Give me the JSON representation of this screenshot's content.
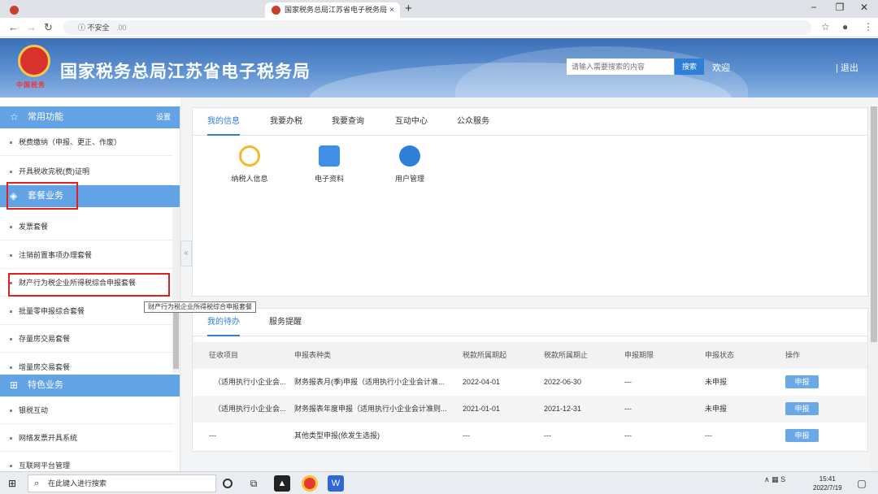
{
  "browser": {
    "tab_active_title": "国家税务总局江苏省电子税务局",
    "tab_close": "×",
    "new_tab": "+",
    "win_min": "−",
    "win_max": "❐",
    "win_close": "✕",
    "address_security": "ⓘ 不安全",
    "address_host": ".00"
  },
  "header": {
    "site_title": "国家税务总局江苏省电子税务局",
    "emblem_caption": "中国税务",
    "search_placeholder": "请输入需要搜索的内容",
    "search_button": "搜索",
    "welcome": "欢迎",
    "logout": "| 退出"
  },
  "sidebar": {
    "common": {
      "icon": "☆",
      "label": "常用功能",
      "settings": "设置"
    },
    "common_items": [
      "税费缴纳（申报、更正、作废）",
      "开具税收完税(费)证明"
    ],
    "package": {
      "icon": "◈",
      "label": "套餐业务"
    },
    "package_items": [
      "发票套餐",
      "注销前置事项办理套餐",
      "财产行为税企业所得税综合申报套餐",
      "批量零申报综合套餐",
      "存量房交易套餐",
      "增量房交易套餐"
    ],
    "special": {
      "icon": "⊞",
      "label": "特色业务"
    },
    "special_items": [
      "银税互动",
      "网络发票开具系统",
      "互联网平台管理"
    ],
    "tooltip": "财产行为税企业所得税综合申报套餐",
    "collapse": "«"
  },
  "panel1": {
    "tabs": [
      "我的信息",
      "我要办税",
      "我要查询",
      "互动中心",
      "公众服务"
    ],
    "active_tab": 0,
    "icons": [
      {
        "label": "纳税人信息",
        "icon": "taxpayer-info-icon",
        "color": "#f5b82e"
      },
      {
        "label": "电子资料",
        "icon": "e-documents-icon",
        "color": "#3f8fe6"
      },
      {
        "label": "用户管理",
        "icon": "user-management-icon",
        "color": "#2f7fd6"
      }
    ]
  },
  "panel2": {
    "tabs": [
      "我的待办",
      "服务提醒"
    ],
    "active_tab": 0,
    "columns": [
      "征收项目",
      "申报表种类",
      "税款所属期起",
      "税款所属期止",
      "申报期限",
      "申报状态",
      "操作"
    ],
    "rows": [
      [
        "（适用执行小企业会...",
        "财务报表月(季)申报（适用执行小企业会计准...",
        "2022-04-01",
        "2022-06-30",
        "---",
        "未申报",
        "申报"
      ],
      [
        "（适用执行小企业会...",
        "财务报表年度申报（适用执行小企业会计准则...",
        "2021-01-01",
        "2021-12-31",
        "---",
        "未申报",
        "申报"
      ],
      [
        "---",
        "其他类型申报(依发生选报)",
        "---",
        "---",
        "---",
        "---",
        "申报"
      ]
    ]
  },
  "taskbar": {
    "start": "⊞",
    "search_placeholder": "在此键入进行搜索",
    "tray": "∧ ▦ S",
    "time": "15:41",
    "date": "2022/7/19",
    "notify": "▢"
  }
}
